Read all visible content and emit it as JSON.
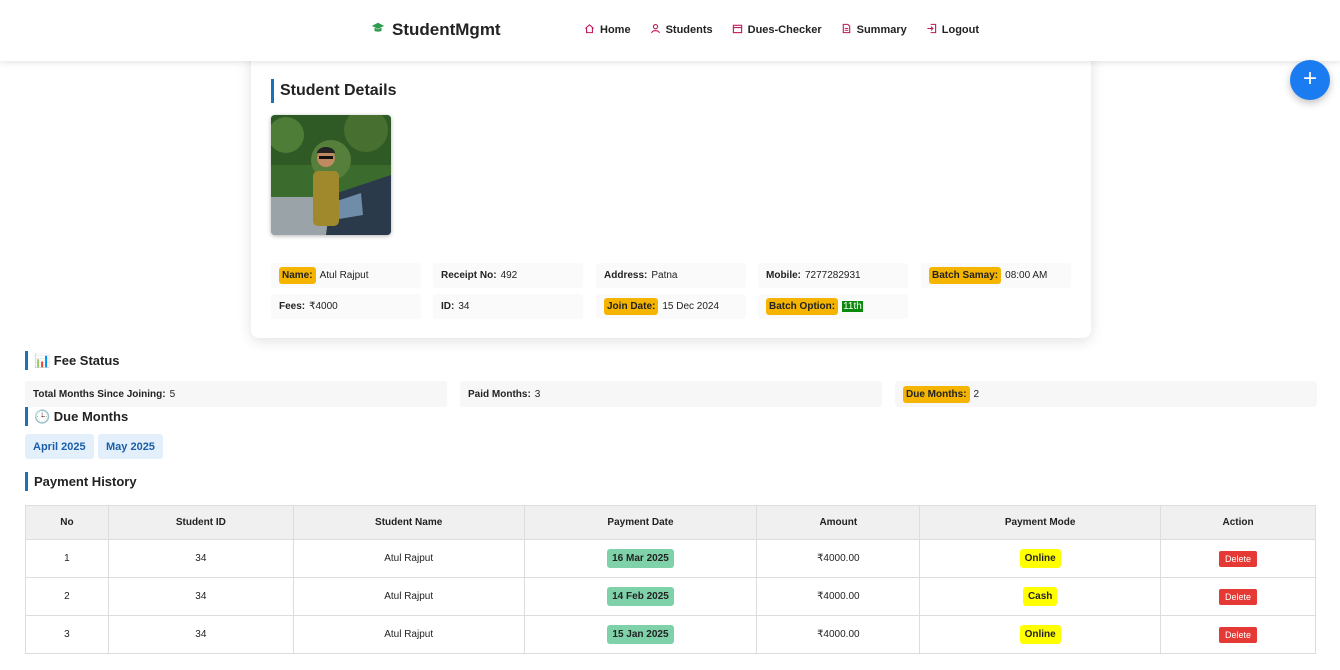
{
  "brand": {
    "name": "StudentMgmt",
    "icon": "graduation-cap-icon"
  },
  "nav": [
    {
      "label": "Home",
      "icon": "home-icon"
    },
    {
      "label": "Students",
      "icon": "user-icon"
    },
    {
      "label": "Dues-Checker",
      "icon": "calendar-icon"
    },
    {
      "label": "Summary",
      "icon": "document-icon"
    },
    {
      "label": "Logout",
      "icon": "logout-icon"
    }
  ],
  "fab": {
    "label": "+"
  },
  "details": {
    "title": "Student Details",
    "fields": {
      "name": {
        "label": "Name:",
        "value": "Atul Rajput"
      },
      "receipt": {
        "label": "Receipt No:",
        "value": "492"
      },
      "address": {
        "label": "Address:",
        "value": "Patna"
      },
      "mobile": {
        "label": "Mobile:",
        "value": "7277282931"
      },
      "batch_samay": {
        "label": "Batch Samay:",
        "value": "08:00 AM"
      },
      "fees": {
        "label": "Fees:",
        "value": "₹4000"
      },
      "id": {
        "label": "ID:",
        "value": "34"
      },
      "join_date": {
        "label": "Join Date:",
        "value": "15 Dec 2024"
      },
      "batch_option": {
        "label": "Batch Option:",
        "value": "11th"
      }
    }
  },
  "fee_status": {
    "title": "📊 Fee Status",
    "total": {
      "label": "Total Months Since Joining:",
      "value": "5"
    },
    "paid": {
      "label": "Paid Months:",
      "value": "3"
    },
    "due": {
      "label": "Due Months:",
      "value": "2"
    }
  },
  "due_months": {
    "title": "🕒 Due Months",
    "months": [
      "April 2025",
      "May 2025"
    ]
  },
  "payment_history": {
    "title": "Payment History",
    "columns": [
      "No",
      "Student ID",
      "Student Name",
      "Payment Date",
      "Amount",
      "Payment Mode",
      "Action"
    ],
    "rows": [
      {
        "no": "1",
        "student_id": "34",
        "name": "Atul Rajput",
        "date": "16 Mar 2025",
        "amount": "₹4000.00",
        "mode": "Online",
        "action": "Delete"
      },
      {
        "no": "2",
        "student_id": "34",
        "name": "Atul Rajput",
        "date": "14 Feb 2025",
        "amount": "₹4000.00",
        "mode": "Cash",
        "action": "Delete"
      },
      {
        "no": "3",
        "student_id": "34",
        "name": "Atul Rajput",
        "date": "15 Jan 2025",
        "amount": "₹4000.00",
        "mode": "Online",
        "action": "Delete"
      }
    ]
  }
}
